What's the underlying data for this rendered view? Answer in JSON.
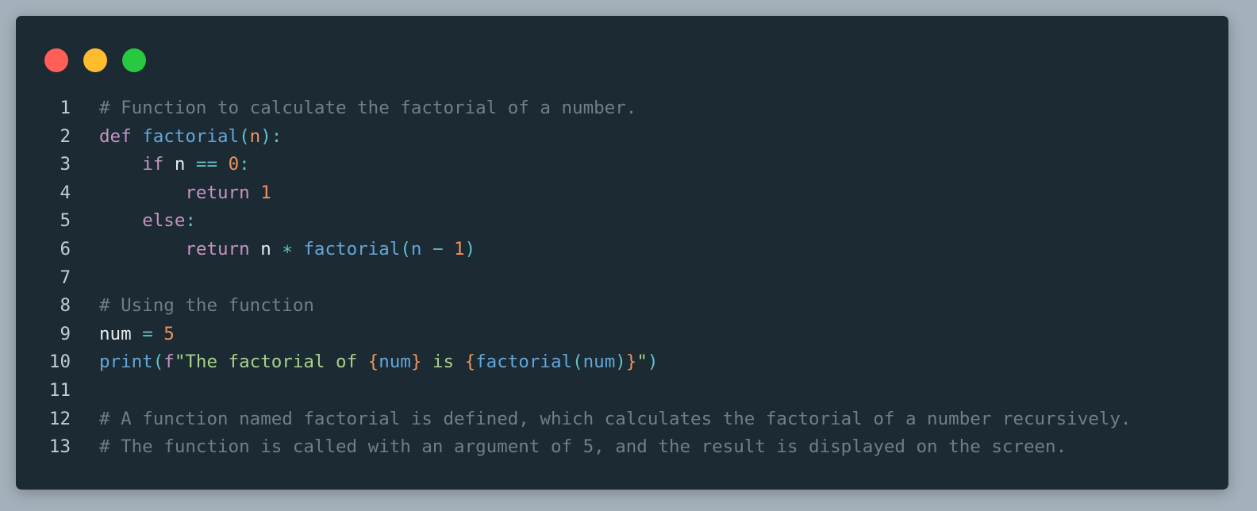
{
  "window": {
    "controls": [
      {
        "name": "close-button",
        "color": "#ff5f57"
      },
      {
        "name": "minimize-button",
        "color": "#febc2e"
      },
      {
        "name": "maximize-button",
        "color": "#28c840"
      }
    ]
  },
  "colors": {
    "background": "#1b2a33",
    "line_number": "#c3ccd4",
    "comment": "#6f7f8a",
    "keyword": "#c792c4",
    "function": "#64a6d8",
    "variable": "#e7ecef",
    "number": "#f0925a",
    "operator": "#5fc3c8",
    "string": "#a9d08a",
    "punct": "#5fc3c8"
  },
  "code": {
    "language": "python",
    "lines": [
      {
        "number": "1",
        "tokens": [
          {
            "t": "comment",
            "v": "# Function to calculate the factorial of a number."
          }
        ]
      },
      {
        "number": "2",
        "tokens": [
          {
            "t": "keyword",
            "v": "def"
          },
          {
            "t": "variable",
            "v": " "
          },
          {
            "t": "function",
            "v": "factorial"
          },
          {
            "t": "punct",
            "v": "("
          },
          {
            "t": "number",
            "v": "n"
          },
          {
            "t": "punct",
            "v": "):"
          }
        ]
      },
      {
        "number": "3",
        "tokens": [
          {
            "t": "variable",
            "v": "    "
          },
          {
            "t": "keyword",
            "v": "if"
          },
          {
            "t": "variable",
            "v": " n "
          },
          {
            "t": "operator",
            "v": "=="
          },
          {
            "t": "variable",
            "v": " "
          },
          {
            "t": "number",
            "v": "0"
          },
          {
            "t": "punct",
            "v": ":"
          }
        ]
      },
      {
        "number": "4",
        "tokens": [
          {
            "t": "variable",
            "v": "        "
          },
          {
            "t": "keyword",
            "v": "return"
          },
          {
            "t": "variable",
            "v": " "
          },
          {
            "t": "number",
            "v": "1"
          }
        ]
      },
      {
        "number": "5",
        "tokens": [
          {
            "t": "variable",
            "v": "    "
          },
          {
            "t": "keyword",
            "v": "else"
          },
          {
            "t": "punct",
            "v": ":"
          }
        ]
      },
      {
        "number": "6",
        "tokens": [
          {
            "t": "variable",
            "v": "        "
          },
          {
            "t": "keyword",
            "v": "return"
          },
          {
            "t": "variable",
            "v": " n "
          },
          {
            "t": "operator",
            "v": "∗"
          },
          {
            "t": "variable",
            "v": " "
          },
          {
            "t": "function",
            "v": "factorial"
          },
          {
            "t": "punct",
            "v": "("
          },
          {
            "t": "function",
            "v": "n"
          },
          {
            "t": "variable",
            "v": " "
          },
          {
            "t": "operator",
            "v": "−"
          },
          {
            "t": "variable",
            "v": " "
          },
          {
            "t": "number",
            "v": "1"
          },
          {
            "t": "punct",
            "v": ")"
          }
        ]
      },
      {
        "number": "7",
        "tokens": []
      },
      {
        "number": "8",
        "tokens": [
          {
            "t": "comment",
            "v": "# Using the function"
          }
        ]
      },
      {
        "number": "9",
        "tokens": [
          {
            "t": "variable",
            "v": "num "
          },
          {
            "t": "operator",
            "v": "="
          },
          {
            "t": "variable",
            "v": " "
          },
          {
            "t": "number",
            "v": "5"
          }
        ]
      },
      {
        "number": "10",
        "tokens": [
          {
            "t": "function",
            "v": "print"
          },
          {
            "t": "punct",
            "v": "("
          },
          {
            "t": "keyword",
            "v": "f"
          },
          {
            "t": "string",
            "v": "\"The factorial of "
          },
          {
            "t": "number",
            "v": "{"
          },
          {
            "t": "function",
            "v": "num"
          },
          {
            "t": "number",
            "v": "}"
          },
          {
            "t": "string",
            "v": " is "
          },
          {
            "t": "number",
            "v": "{"
          },
          {
            "t": "function",
            "v": "factorial"
          },
          {
            "t": "punct",
            "v": "("
          },
          {
            "t": "function",
            "v": "num"
          },
          {
            "t": "punct",
            "v": ")"
          },
          {
            "t": "number",
            "v": "}"
          },
          {
            "t": "string",
            "v": "\""
          },
          {
            "t": "punct",
            "v": ")"
          }
        ]
      },
      {
        "number": "11",
        "tokens": []
      },
      {
        "number": "12",
        "tokens": [
          {
            "t": "comment",
            "v": "# A function named factorial is defined, which calculates the factorial of a number recursively."
          }
        ]
      },
      {
        "number": "13",
        "tokens": [
          {
            "t": "comment",
            "v": "# The function is called with an argument of 5, and the result is displayed on the screen."
          }
        ]
      }
    ]
  }
}
